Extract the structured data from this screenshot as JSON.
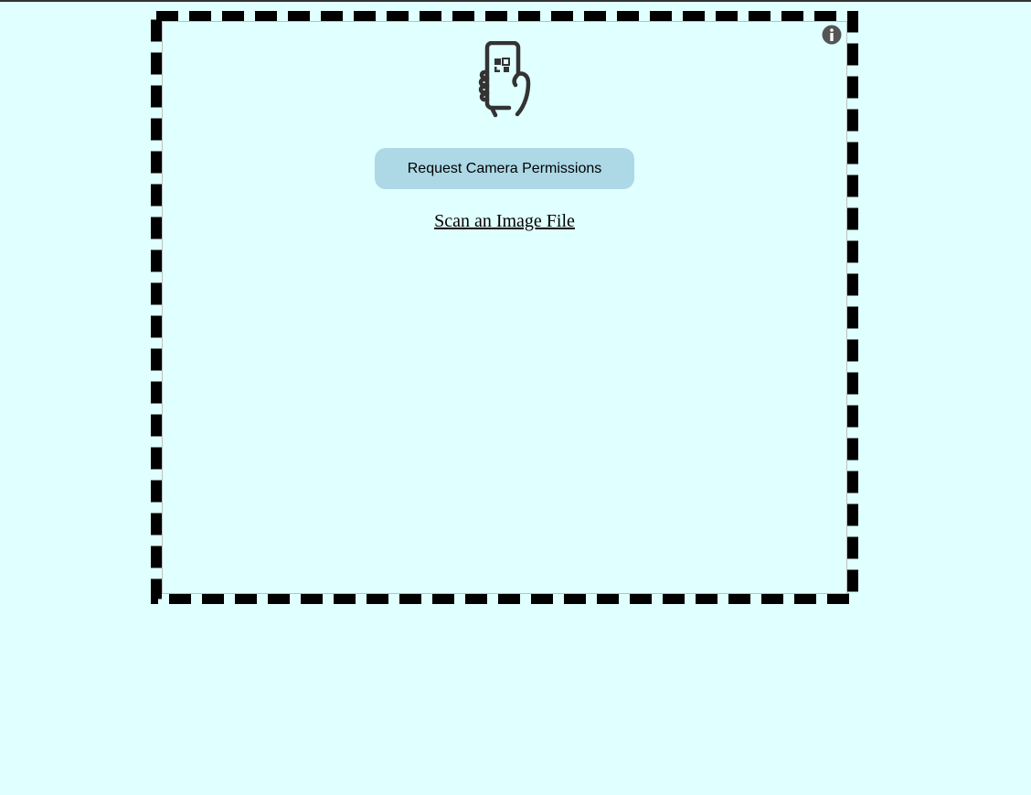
{
  "page": {
    "background_color": "#e0ffff"
  },
  "scanner": {
    "frame_color": "#000000",
    "info_icon": "info-circle-icon",
    "illustration_icon": "phone-qr-scan-icon",
    "permission_button_label": "Request Camera Permissions",
    "permission_button_color": "#add8e6",
    "scan_file_label": "Scan an Image File"
  }
}
